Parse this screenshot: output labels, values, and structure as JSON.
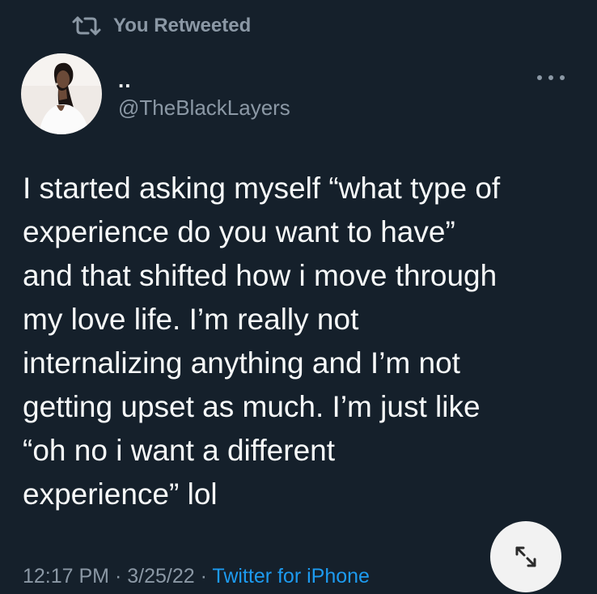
{
  "retweet_banner": {
    "icon": "retweet-icon",
    "text": "You Retweeted"
  },
  "author": {
    "display_name": "..",
    "handle": "@TheBlackLayers"
  },
  "tweet": {
    "lines": [
      "I started asking myself “what type of",
      "experience do you want to have”",
      "and that shifted how i move through",
      "my love life. I’m really not",
      "internalizing anything and I’m not",
      "getting upset as much. I’m just like",
      "“oh no i want a different",
      "experience” lol"
    ]
  },
  "meta": {
    "time": "12:17 PM",
    "sep1": " · ",
    "date": "3/25/22",
    "sep2": " · ",
    "source": "Twitter for iPhone"
  },
  "controls": {
    "more_icon": "more-horizontal-icon",
    "expand_icon": "expand-arrows-icon"
  },
  "colors": {
    "background": "#15202b",
    "primary_text": "#f7f9f9",
    "secondary_text": "#8b98a5",
    "link": "#1d9bf0",
    "expand_button_bg": "#f2f2f2"
  }
}
